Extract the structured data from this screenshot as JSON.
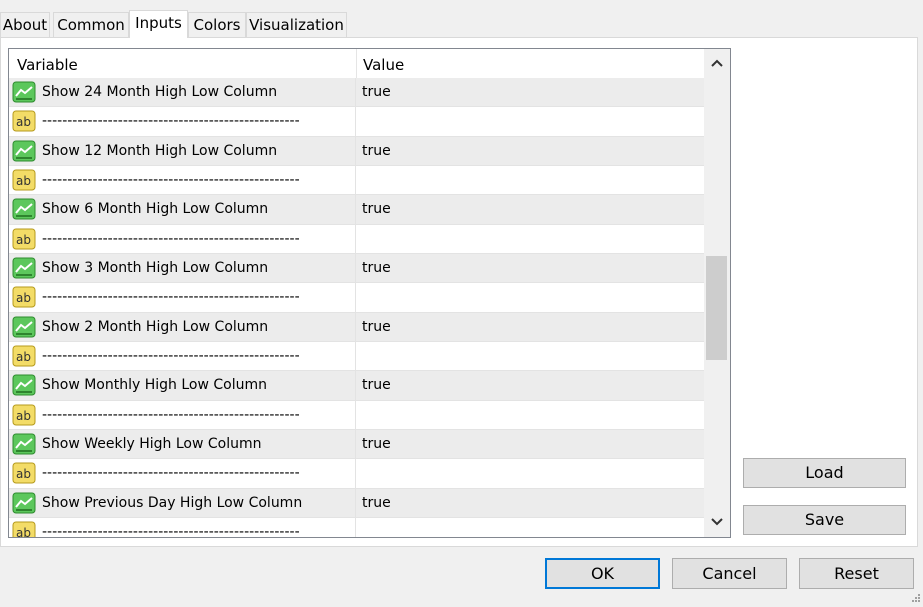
{
  "tabs": [
    {
      "label": "About"
    },
    {
      "label": "Common"
    },
    {
      "label": "Inputs",
      "active": true
    },
    {
      "label": "Colors"
    },
    {
      "label": "Visualization"
    }
  ],
  "grid": {
    "header": {
      "variable": "Variable",
      "value": "Value"
    },
    "rows": [
      {
        "type": "bool",
        "label": "Show 24 Month High Low Column",
        "value": "true"
      },
      {
        "type": "string",
        "label": "---------------------------------------------------",
        "value": ""
      },
      {
        "type": "bool",
        "label": "Show 12 Month High Low Column",
        "value": "true"
      },
      {
        "type": "string",
        "label": "---------------------------------------------------",
        "value": ""
      },
      {
        "type": "bool",
        "label": "Show 6 Month High Low Column",
        "value": "true"
      },
      {
        "type": "string",
        "label": "---------------------------------------------------",
        "value": ""
      },
      {
        "type": "bool",
        "label": "Show 3 Month High Low Column",
        "value": "true"
      },
      {
        "type": "string",
        "label": "---------------------------------------------------",
        "value": ""
      },
      {
        "type": "bool",
        "label": "Show 2 Month High Low Column",
        "value": "true"
      },
      {
        "type": "string",
        "label": "---------------------------------------------------",
        "value": ""
      },
      {
        "type": "bool",
        "label": "Show Monthly High Low Column",
        "value": "true"
      },
      {
        "type": "string",
        "label": "---------------------------------------------------",
        "value": ""
      },
      {
        "type": "bool",
        "label": "Show Weekly High Low Column",
        "value": "true"
      },
      {
        "type": "string",
        "label": "---------------------------------------------------",
        "value": ""
      },
      {
        "type": "bool",
        "label": "Show Previous Day High Low Column",
        "value": "true"
      },
      {
        "type": "string",
        "label": "---------------------------------------------------",
        "value": ""
      }
    ]
  },
  "icons": {
    "bool": "chart-line-icon",
    "string": "ab-text-icon"
  },
  "side_buttons": {
    "load": "Load",
    "save": "Save"
  },
  "footer_buttons": {
    "ok": "OK",
    "cancel": "Cancel",
    "reset": "Reset"
  },
  "colors": {
    "accent": "#0078d7",
    "bool_icon": "#3cb44b",
    "string_icon": "#f2d95c"
  }
}
